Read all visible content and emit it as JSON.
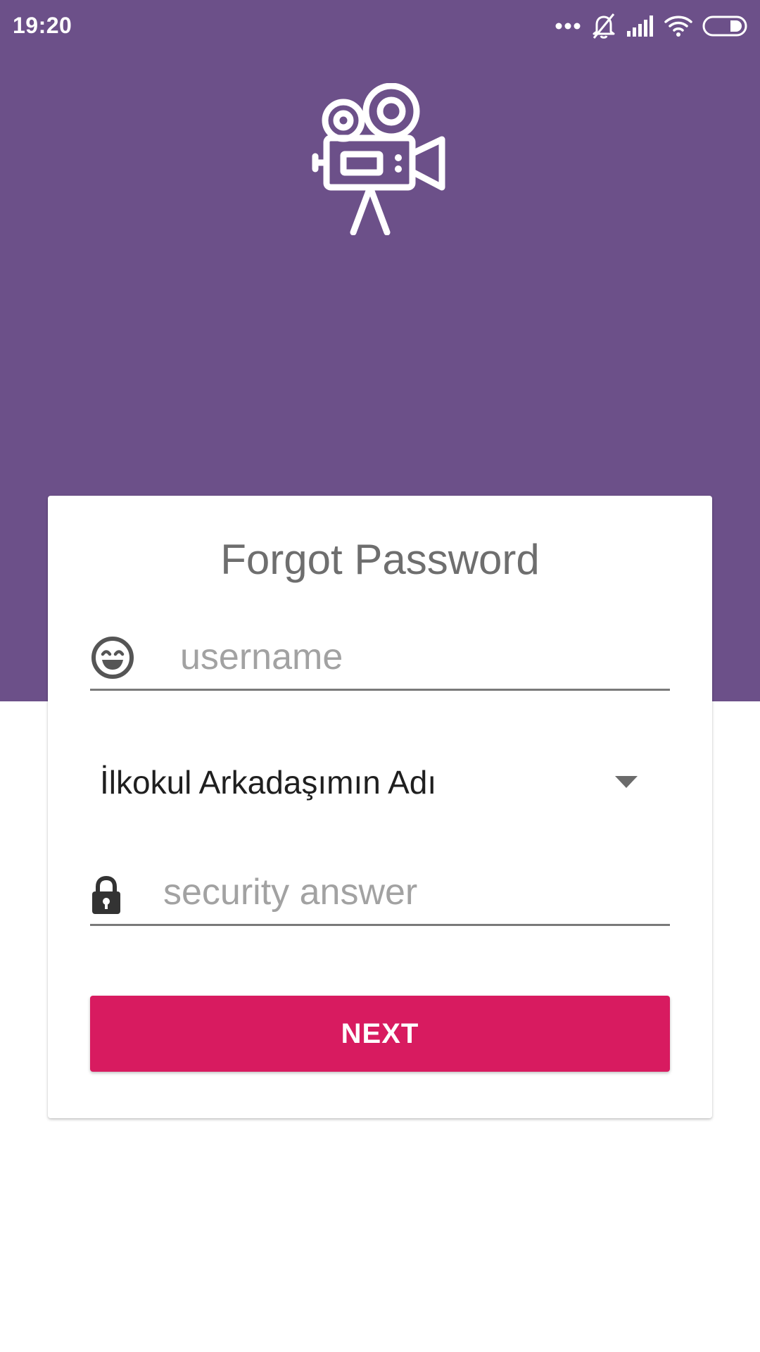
{
  "status_bar": {
    "time": "19:20",
    "icons": [
      "more-dots-icon",
      "notifications-off-icon",
      "signal-icon",
      "wifi-icon",
      "battery-icon"
    ]
  },
  "header": {
    "logo_icon": "movie-camera-icon",
    "background_color": "#6c5089"
  },
  "form": {
    "title": "Forgot Password",
    "username": {
      "icon": "smiley-icon",
      "placeholder": "username",
      "value": ""
    },
    "security_question": {
      "selected": "İlkokul Arkadaşımın Adı"
    },
    "security_answer": {
      "icon": "lock-icon",
      "placeholder": "security answer",
      "value": ""
    },
    "next_label": "NEXT",
    "accent_color": "#d81b60"
  }
}
